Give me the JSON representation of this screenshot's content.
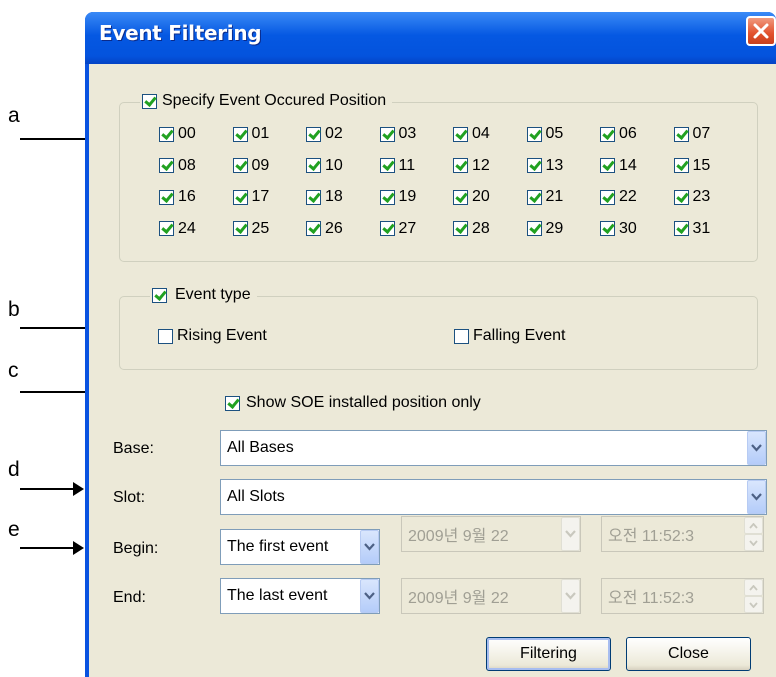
{
  "annotations": [
    "a",
    "b",
    "c",
    "d",
    "e"
  ],
  "window": {
    "title": "Event Filtering"
  },
  "position_group": {
    "label": "Specify Event Occured Position",
    "checked": true,
    "items": [
      "00",
      "01",
      "02",
      "03",
      "04",
      "05",
      "06",
      "07",
      "08",
      "09",
      "10",
      "11",
      "12",
      "13",
      "14",
      "15",
      "16",
      "17",
      "18",
      "19",
      "20",
      "21",
      "22",
      "23",
      "24",
      "25",
      "26",
      "27",
      "28",
      "29",
      "30",
      "31"
    ]
  },
  "event_type": {
    "label": "Event type",
    "checked": true,
    "rising": {
      "label": "Rising Event",
      "checked": false
    },
    "falling": {
      "label": "Falling Event",
      "checked": false
    }
  },
  "soe": {
    "label": "Show SOE installed position only",
    "checked": true
  },
  "base": {
    "label": "Base:",
    "value": "All Bases"
  },
  "slot": {
    "label": "Slot:",
    "value": "All Slots"
  },
  "begin": {
    "label": "Begin:",
    "mode": "The first event",
    "date": "2009년  9월 22",
    "time": "오전 11:52:3"
  },
  "end": {
    "label": "End:",
    "mode": "The last event",
    "date": "2009년  9월 22",
    "time": "오전 11:52:3"
  },
  "buttons": {
    "filtering": "Filtering",
    "close": "Close"
  }
}
